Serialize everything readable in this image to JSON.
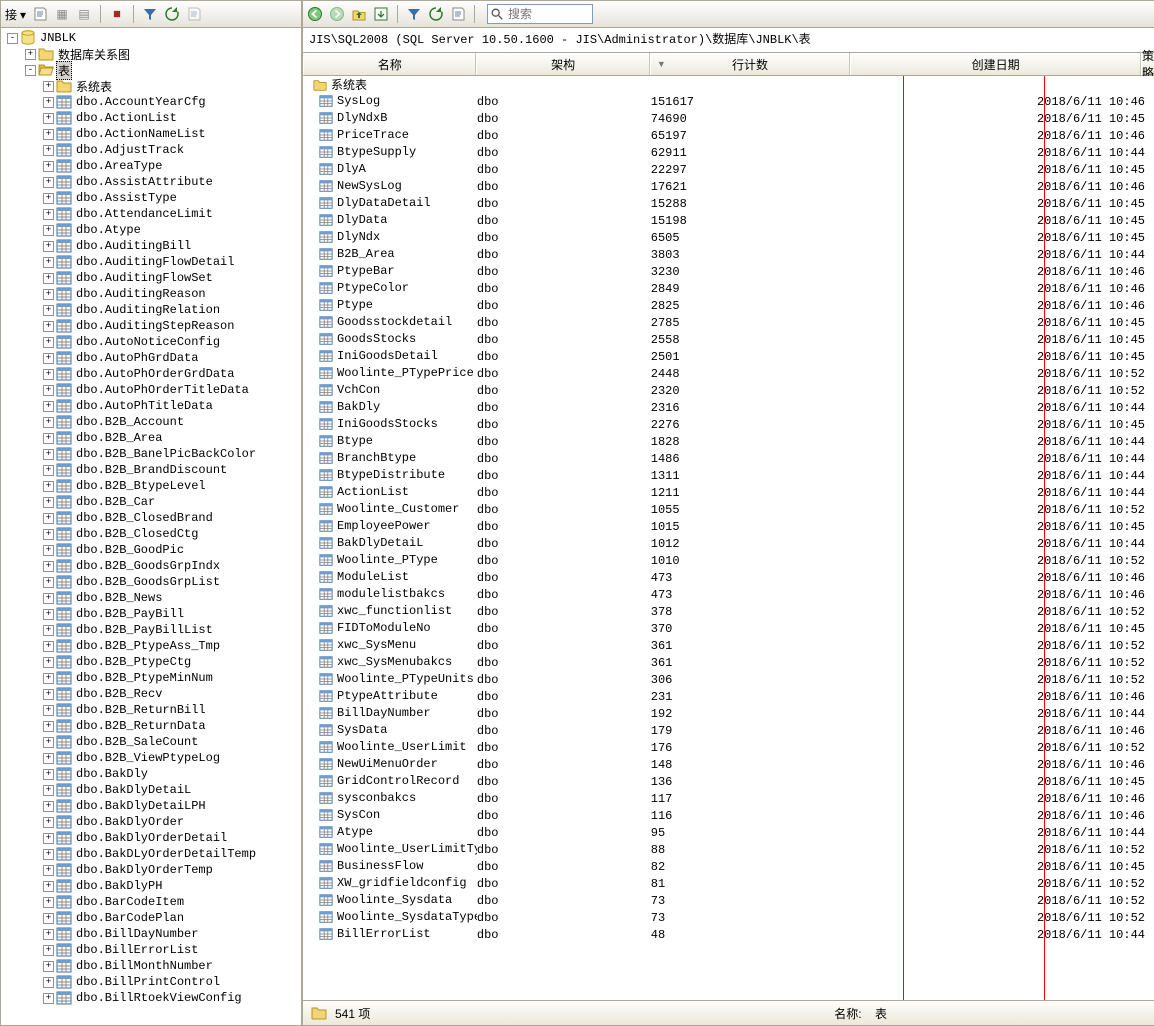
{
  "toolbar_left": {
    "conn_label": "接 ▾"
  },
  "search": {
    "placeholder": "搜索"
  },
  "breadcrumb": "JIS\\SQL2008 (SQL Server 10.50.1600 - JIS\\Administrator)\\数据库\\JNBLK\\表",
  "columns": {
    "name": "名称",
    "schema": "架构",
    "rowcount": "行计数",
    "created": "创建日期",
    "policy": "策略"
  },
  "group_label": "系统表",
  "status": {
    "count": "541 项",
    "name_label": "名称:",
    "type_value": "表"
  },
  "tree": {
    "db": "JNBLK",
    "n1": "数据库关系图",
    "n2": "表",
    "n3": "系统表",
    "items": [
      "dbo.AccountYearCfg",
      "dbo.ActionList",
      "dbo.ActionNameList",
      "dbo.AdjustTrack",
      "dbo.AreaType",
      "dbo.AssistAttribute",
      "dbo.AssistType",
      "dbo.AttendanceLimit",
      "dbo.Atype",
      "dbo.AuditingBill",
      "dbo.AuditingFlowDetail",
      "dbo.AuditingFlowSet",
      "dbo.AuditingReason",
      "dbo.AuditingRelation",
      "dbo.AuditingStepReason",
      "dbo.AutoNoticeConfig",
      "dbo.AutoPhGrdData",
      "dbo.AutoPhOrderGrdData",
      "dbo.AutoPhOrderTitleData",
      "dbo.AutoPhTitleData",
      "dbo.B2B_Account",
      "dbo.B2B_Area",
      "dbo.B2B_BanelPicBackColor",
      "dbo.B2B_BrandDiscount",
      "dbo.B2B_BtypeLevel",
      "dbo.B2B_Car",
      "dbo.B2B_ClosedBrand",
      "dbo.B2B_ClosedCtg",
      "dbo.B2B_GoodPic",
      "dbo.B2B_GoodsGrpIndx",
      "dbo.B2B_GoodsGrpList",
      "dbo.B2B_News",
      "dbo.B2B_PayBill",
      "dbo.B2B_PayBillList",
      "dbo.B2B_PtypeAss_Tmp",
      "dbo.B2B_PtypeCtg",
      "dbo.B2B_PtypeMinNum",
      "dbo.B2B_Recv",
      "dbo.B2B_ReturnBill",
      "dbo.B2B_ReturnData",
      "dbo.B2B_SaleCount",
      "dbo.B2B_ViewPtypeLog",
      "dbo.BakDly",
      "dbo.BakDlyDetaiL",
      "dbo.BakDlyDetaiLPH",
      "dbo.BakDlyOrder",
      "dbo.BakDlyOrderDetail",
      "dbo.BakDLyOrderDetailTemp",
      "dbo.BakDlyOrderTemp",
      "dbo.BakDlyPH",
      "dbo.BarCodeItem",
      "dbo.BarCodePlan",
      "dbo.BillDayNumber",
      "dbo.BillErrorList",
      "dbo.BillMonthNumber",
      "dbo.BillPrintControl",
      "dbo.BillRtoekViewConfig"
    ]
  },
  "rows": [
    {
      "n": "SysLog",
      "s": "dbo",
      "r": "151617",
      "d": "2018/6/11 10:46"
    },
    {
      "n": "DlyNdxB",
      "s": "dbo",
      "r": "74690",
      "d": "2018/6/11 10:45"
    },
    {
      "n": "PriceTrace",
      "s": "dbo",
      "r": "65197",
      "d": "2018/6/11 10:46"
    },
    {
      "n": "BtypeSupply",
      "s": "dbo",
      "r": "62911",
      "d": "2018/6/11 10:44"
    },
    {
      "n": "DlyA",
      "s": "dbo",
      "r": "22297",
      "d": "2018/6/11 10:45"
    },
    {
      "n": "NewSysLog",
      "s": "dbo",
      "r": "17621",
      "d": "2018/6/11 10:46"
    },
    {
      "n": "DlyDataDetail",
      "s": "dbo",
      "r": "15288",
      "d": "2018/6/11 10:45"
    },
    {
      "n": "DlyData",
      "s": "dbo",
      "r": "15198",
      "d": "2018/6/11 10:45"
    },
    {
      "n": "DlyNdx",
      "s": "dbo",
      "r": "6505",
      "d": "2018/6/11 10:45"
    },
    {
      "n": "B2B_Area",
      "s": "dbo",
      "r": "3803",
      "d": "2018/6/11 10:44"
    },
    {
      "n": "PtypeBar",
      "s": "dbo",
      "r": "3230",
      "d": "2018/6/11 10:46"
    },
    {
      "n": "PtypeColor",
      "s": "dbo",
      "r": "2849",
      "d": "2018/6/11 10:46"
    },
    {
      "n": "Ptype",
      "s": "dbo",
      "r": "2825",
      "d": "2018/6/11 10:46"
    },
    {
      "n": "Goodsstockdetail",
      "s": "dbo",
      "r": "2785",
      "d": "2018/6/11 10:45"
    },
    {
      "n": "GoodsStocks",
      "s": "dbo",
      "r": "2558",
      "d": "2018/6/11 10:45"
    },
    {
      "n": "IniGoodsDetail",
      "s": "dbo",
      "r": "2501",
      "d": "2018/6/11 10:45"
    },
    {
      "n": "Woolinte_PTypePrice",
      "s": "dbo",
      "r": "2448",
      "d": "2018/6/11 10:52"
    },
    {
      "n": "VchCon",
      "s": "dbo",
      "r": "2320",
      "d": "2018/6/11 10:52"
    },
    {
      "n": "BakDly",
      "s": "dbo",
      "r": "2316",
      "d": "2018/6/11 10:44"
    },
    {
      "n": "IniGoodsStocks",
      "s": "dbo",
      "r": "2276",
      "d": "2018/6/11 10:45"
    },
    {
      "n": "Btype",
      "s": "dbo",
      "r": "1828",
      "d": "2018/6/11 10:44"
    },
    {
      "n": "BranchBtype",
      "s": "dbo",
      "r": "1486",
      "d": "2018/6/11 10:44"
    },
    {
      "n": "BtypeDistribute",
      "s": "dbo",
      "r": "1311",
      "d": "2018/6/11 10:44"
    },
    {
      "n": "ActionList",
      "s": "dbo",
      "r": "1211",
      "d": "2018/6/11 10:44"
    },
    {
      "n": "Woolinte_Customer",
      "s": "dbo",
      "r": "1055",
      "d": "2018/6/11 10:52"
    },
    {
      "n": "EmployeePower",
      "s": "dbo",
      "r": "1015",
      "d": "2018/6/11 10:45"
    },
    {
      "n": "BakDlyDetaiL",
      "s": "dbo",
      "r": "1012",
      "d": "2018/6/11 10:44"
    },
    {
      "n": "Woolinte_PType",
      "s": "dbo",
      "r": "1010",
      "d": "2018/6/11 10:52"
    },
    {
      "n": "ModuleList",
      "s": "dbo",
      "r": "473",
      "d": "2018/6/11 10:46"
    },
    {
      "n": "modulelistbakcs",
      "s": "dbo",
      "r": "473",
      "d": "2018/6/11 10:46"
    },
    {
      "n": "xwc_functionlist",
      "s": "dbo",
      "r": "378",
      "d": "2018/6/11 10:52"
    },
    {
      "n": "FIDToModuleNo",
      "s": "dbo",
      "r": "370",
      "d": "2018/6/11 10:45"
    },
    {
      "n": "xwc_SysMenu",
      "s": "dbo",
      "r": "361",
      "d": "2018/6/11 10:52"
    },
    {
      "n": "xwc_SysMenubakcs",
      "s": "dbo",
      "r": "361",
      "d": "2018/6/11 10:52"
    },
    {
      "n": "Woolinte_PTypeUnits",
      "s": "dbo",
      "r": "306",
      "d": "2018/6/11 10:52"
    },
    {
      "n": "PtypeAttribute",
      "s": "dbo",
      "r": "231",
      "d": "2018/6/11 10:46"
    },
    {
      "n": "BillDayNumber",
      "s": "dbo",
      "r": "192",
      "d": "2018/6/11 10:44"
    },
    {
      "n": "SysData",
      "s": "dbo",
      "r": "179",
      "d": "2018/6/11 10:46"
    },
    {
      "n": "Woolinte_UserLimit",
      "s": "dbo",
      "r": "176",
      "d": "2018/6/11 10:52"
    },
    {
      "n": "NewUiMenuOrder",
      "s": "dbo",
      "r": "148",
      "d": "2018/6/11 10:46"
    },
    {
      "n": "GridControlRecord",
      "s": "dbo",
      "r": "136",
      "d": "2018/6/11 10:45"
    },
    {
      "n": "sysconbakcs",
      "s": "dbo",
      "r": "117",
      "d": "2018/6/11 10:46"
    },
    {
      "n": "SysCon",
      "s": "dbo",
      "r": "116",
      "d": "2018/6/11 10:46"
    },
    {
      "n": "Atype",
      "s": "dbo",
      "r": "95",
      "d": "2018/6/11 10:44"
    },
    {
      "n": "Woolinte_UserLimitType",
      "s": "dbo",
      "r": "88",
      "d": "2018/6/11 10:52"
    },
    {
      "n": "BusinessFlow",
      "s": "dbo",
      "r": "82",
      "d": "2018/6/11 10:45"
    },
    {
      "n": "XW_gridfieldconfig",
      "s": "dbo",
      "r": "81",
      "d": "2018/6/11 10:52"
    },
    {
      "n": "Woolinte_Sysdata",
      "s": "dbo",
      "r": "73",
      "d": "2018/6/11 10:52"
    },
    {
      "n": "Woolinte_SysdataType",
      "s": "dbo",
      "r": "73",
      "d": "2018/6/11 10:52"
    },
    {
      "n": "BillErrorList",
      "s": "dbo",
      "r": "48",
      "d": "2018/6/11 10:44"
    }
  ]
}
